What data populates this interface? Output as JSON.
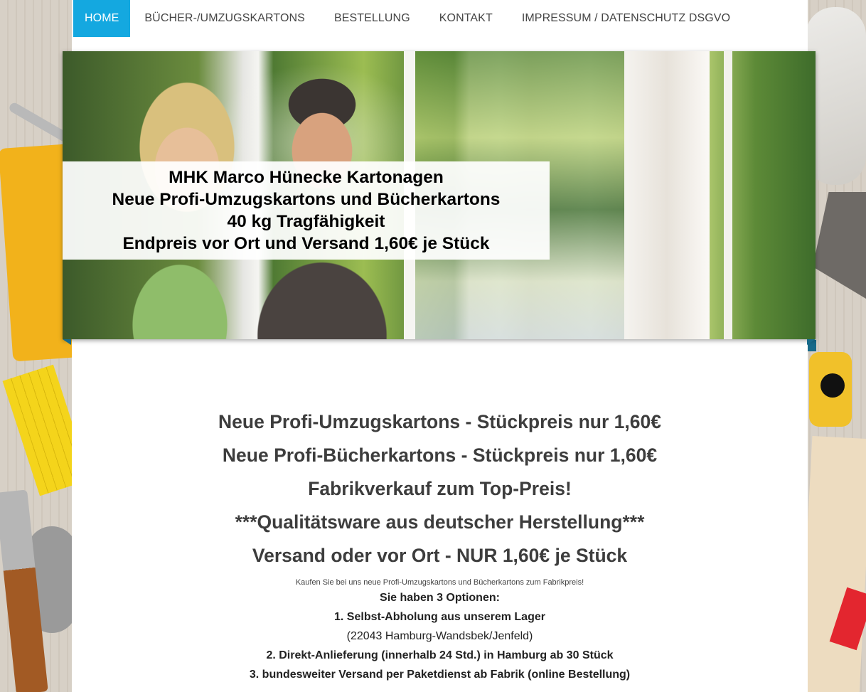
{
  "nav": {
    "items": [
      {
        "label": "HOME",
        "active": true
      },
      {
        "label": "BÜCHER-/UMZUGSKARTONS",
        "active": false
      },
      {
        "label": "BESTELLUNG",
        "active": false
      },
      {
        "label": "KONTAKT",
        "active": false
      },
      {
        "label": "IMPRESSUM / DATENSCHUTZ DSGVO",
        "active": false
      }
    ]
  },
  "hero": {
    "lines": [
      "MHK Marco Hünecke Kartonagen",
      "Neue Profi-Umzugskartons und Bücherkartons",
      "40 kg Tragfähigkeit",
      "Endpreis vor Ort und Versand 1,60€ je Stück"
    ]
  },
  "content": {
    "headlines": [
      "Neue Profi-Umzugskartons - Stückpreis nur 1,60€",
      "Neue Profi-Bücherkartons - Stückpreis nur 1,60€",
      "Fabrikverkauf zum Top-Preis!",
      "***Qualitätsware aus deutscher Herstellung***",
      "Versand oder vor Ort - NUR 1,60€ je Stück"
    ],
    "intro": "Kaufen Sie bei uns neue Profi-Umzugskartons und Bücherkartons zum Fabrikpreis!",
    "options_title": "Sie haben 3 Optionen:",
    "option1": "1. Selbst-Abholung aus unserem Lager",
    "option1_address": "(22043 Hamburg-Wandsbek/Jenfeld)",
    "option2": "2. Direkt-Anlieferung (innerhalb 24 Std.) in Hamburg ab 30 Stück",
    "option3": "3. bundesweiter Versand per Paketdienst ab Fabrik (online Bestellung)"
  },
  "colors": {
    "accent": "#14a8e0",
    "text": "#3d3d3d"
  }
}
